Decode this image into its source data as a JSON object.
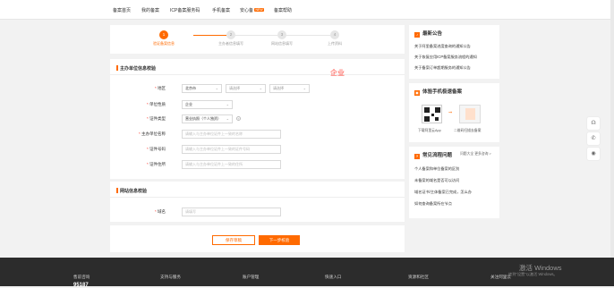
{
  "topnav": {
    "items": [
      "备案首页",
      "我的备案",
      "ICP备案服务码",
      "手机备案",
      "安心备",
      "备案帮助"
    ],
    "badge": "NEW"
  },
  "steps": [
    {
      "num": "1",
      "label": "验证备案信息"
    },
    {
      "num": "2",
      "label": "主办者信息填写"
    },
    {
      "num": "3",
      "label": "网站信息填写"
    },
    {
      "num": "4",
      "label": "上传资料"
    }
  ],
  "form": {
    "section_title": "主办单位信息校验",
    "watermark": "企业",
    "region_label": "地区",
    "region": [
      "北京市",
      "请选择",
      "请选择"
    ],
    "nature_label": "单位性质",
    "nature": "企业",
    "cert_label": "证件类型",
    "cert": "营业执照（个人独资）",
    "name_label": "主办单位名称",
    "name_ph": "请输入与主办单位证件上一致的名称",
    "certno_label": "证件号码",
    "certno_ph": "请输入与主办单位证件上一致的证件号码",
    "addr_label": "证件住所",
    "addr_ph": "请输入与主办单位证件上一致的住所"
  },
  "form2": {
    "section_title": "网站信息校验",
    "domain_label": "域名",
    "domain_ph": "请填写"
  },
  "buttons": {
    "save": "保存草稿",
    "next": "下一步校验"
  },
  "sidebar": {
    "announce": {
      "title": "最新公告",
      "items": [
        "关于阿里备案进度查询的通知公告",
        "关于恢复应用ICP备案服务流程的通知",
        "关于备案订单超期服务的通知公告"
      ]
    },
    "app": {
      "title": "体验手机极速备案",
      "caption1": "下载阿里云App",
      "caption2": "二维码扫描去备案"
    },
    "faq": {
      "title": "常见流程问题",
      "more": "问题大全 更多咨询 >",
      "items": [
        "个人备案和单位备案的区别",
        "未备案的域名是否可以访问",
        "域名证书/主体备案已完成，怎么办",
        "如何查询备案所在节点"
      ]
    }
  },
  "footer": {
    "brand": "售前咨询",
    "phone": "95187",
    "cols": [
      "支持与服务",
      "账户管理",
      "快速入口",
      "资源和社区",
      "关注阿里云"
    ],
    "sub": [
      "...",
      "...",
      "...",
      "...",
      "..."
    ]
  },
  "activation": {
    "line1": "激活 Windows",
    "line2": "转到\"设置\"以激活 Windows。"
  },
  "float_icons": [
    "headset-icon",
    "phone-icon",
    "feedback-icon"
  ]
}
